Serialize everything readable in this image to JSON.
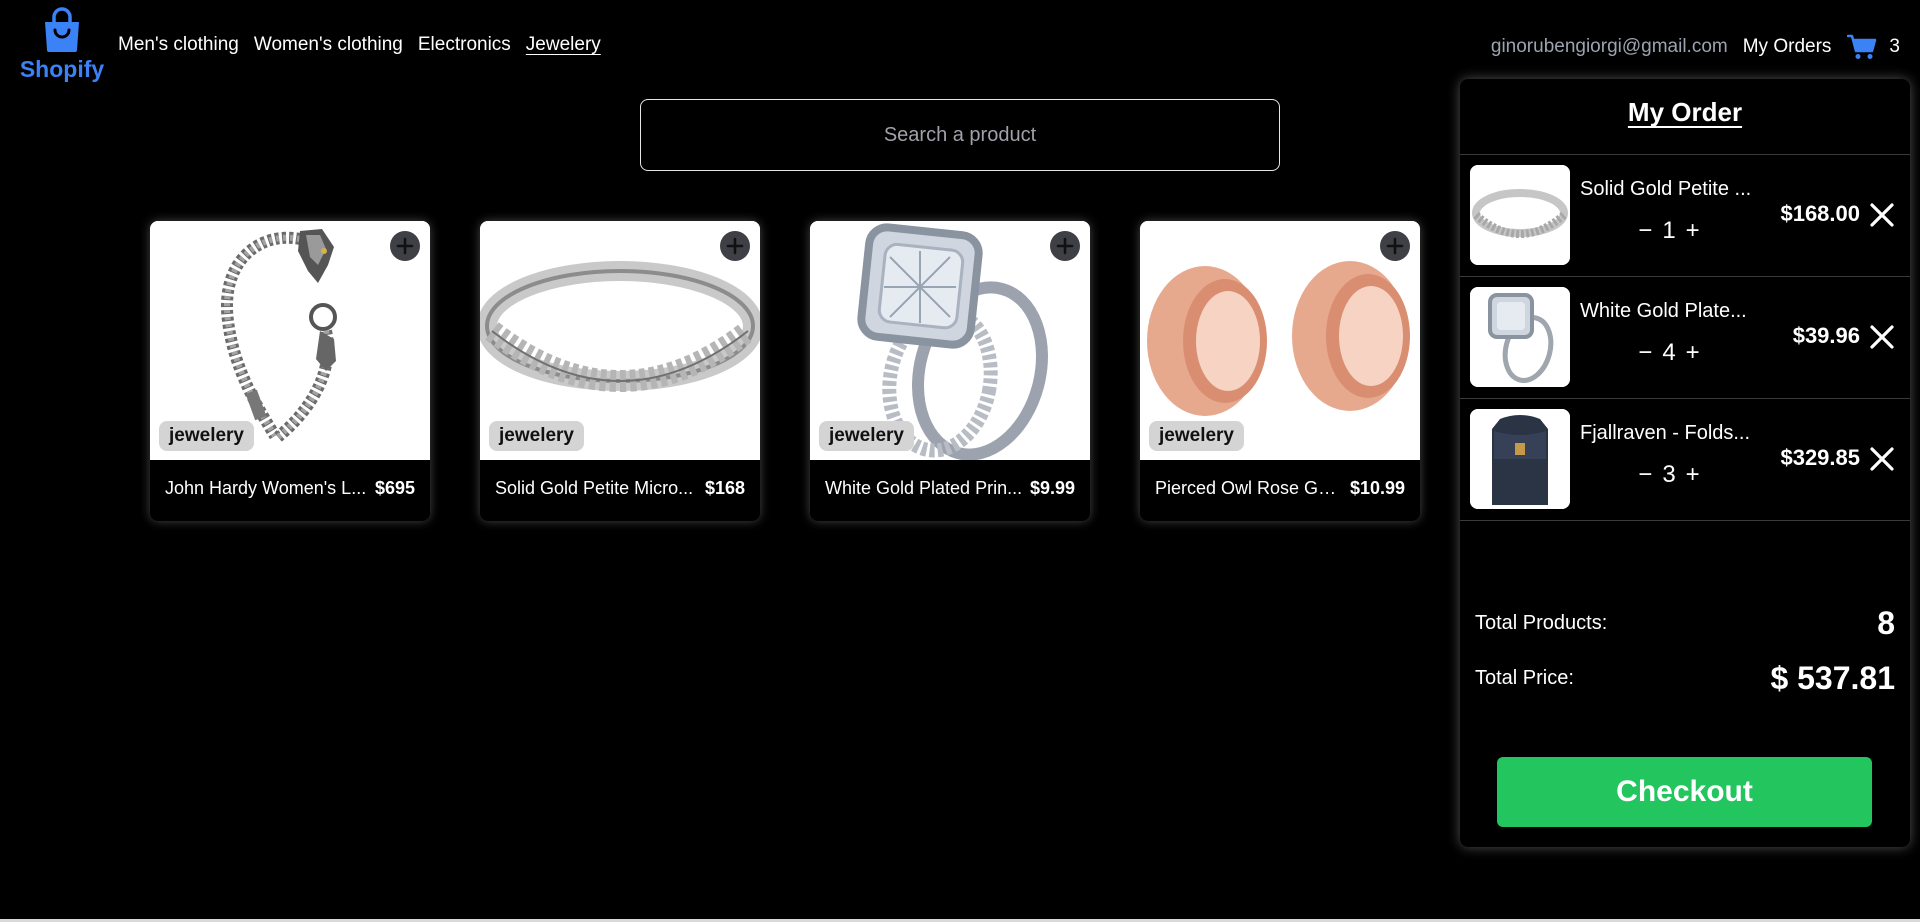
{
  "brand": {
    "name": "Shopify",
    "color": "#3b82f6"
  },
  "nav": {
    "links": [
      "Men's clothing",
      "Women's clothing",
      "Electronics",
      "Jewelery"
    ],
    "active": "Jewelery",
    "email": "ginorubengiorgi@gmail.com",
    "my_orders": "My Orders",
    "cart_count": "3"
  },
  "search": {
    "placeholder": "Search a product"
  },
  "products": [
    {
      "title": "John Hardy Women's L...",
      "price": "$695",
      "category": "jewelery",
      "image": "bracelet-chain"
    },
    {
      "title": "Solid Gold Petite Micro...",
      "price": "$168",
      "category": "jewelery",
      "image": "silver-ring"
    },
    {
      "title": "White Gold Plated Prin...",
      "price": "$9.99",
      "category": "jewelery",
      "image": "diamond-ring"
    },
    {
      "title": "Pierced Owl Rose Gol...",
      "price": "$10.99",
      "category": "jewelery",
      "image": "rose-gold-tunnels"
    }
  ],
  "order": {
    "title": "My Order",
    "items": [
      {
        "name": "Solid Gold Petite ...",
        "qty": "1",
        "price": "$168.00",
        "image": "silver-ring"
      },
      {
        "name": "White Gold Plate...",
        "qty": "4",
        "price": "$39.96",
        "image": "diamond-ring"
      },
      {
        "name": "Fjallraven - Folds...",
        "qty": "3",
        "price": "$329.85",
        "image": "backpack"
      }
    ],
    "total_products_label": "Total Products:",
    "total_products": "8",
    "total_price_label": "Total Price:",
    "total_price": "$ 537.81",
    "checkout": "Checkout",
    "checkout_color": "#22c55e"
  }
}
